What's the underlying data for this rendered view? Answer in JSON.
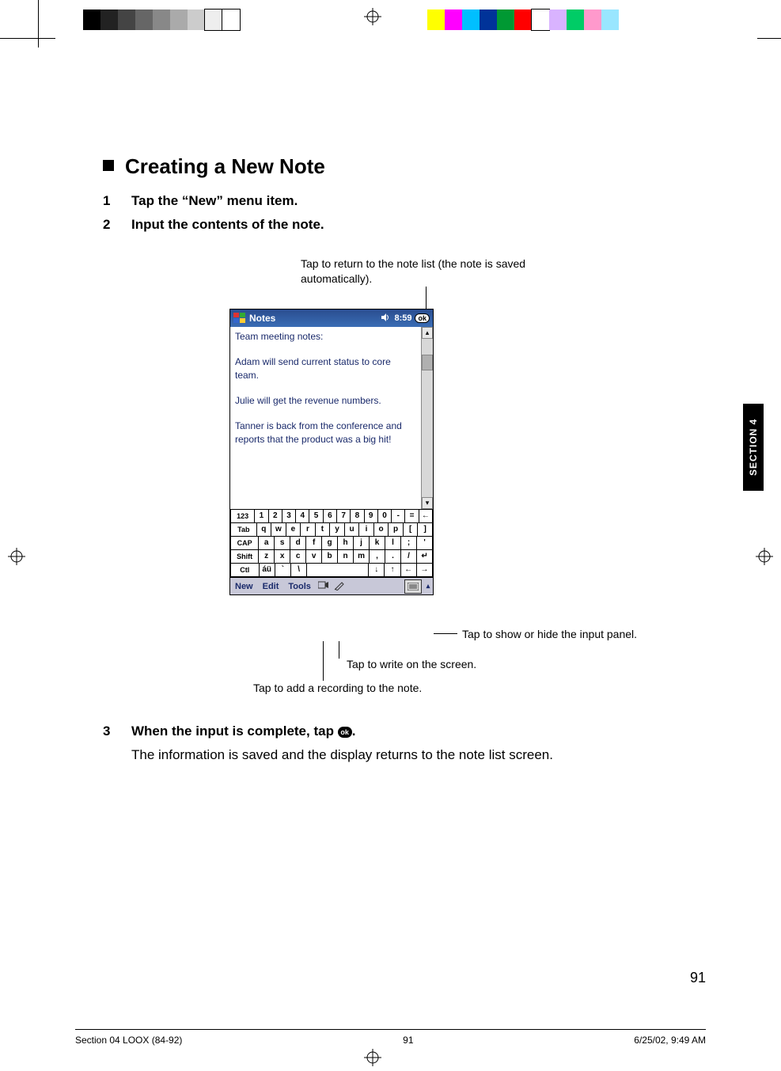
{
  "heading": "Creating a New Note",
  "steps": {
    "s1": {
      "num": "1",
      "text": "Tap the “New” menu item."
    },
    "s2": {
      "num": "2",
      "text": "Input the contents of the note."
    },
    "s3": {
      "num": "3",
      "text_before": "When the input is complete, tap ",
      "text_after": ".",
      "ok_label": "ok",
      "sub": "The information is saved and the display returns to the note list screen."
    }
  },
  "callouts": {
    "ok": "Tap to return to the note list\n(the note is saved automatically).",
    "sip": "Tap to show or hide the input panel.",
    "pen": "Tap to write on the screen.",
    "rec": "Tap to add a recording to the note."
  },
  "screenshot": {
    "title": "Notes",
    "time": "8:59",
    "ok_btn": "ok",
    "note_lines": "Team meeting notes:\n\nAdam will send current status to core team.\n\nJulie will get the revenue numbers.\n\nTanner is back from the conference and reports that the product was a big hit!",
    "keyboard": {
      "row1": [
        "123",
        "1",
        "2",
        "3",
        "4",
        "5",
        "6",
        "7",
        "8",
        "9",
        "0",
        "-",
        "=",
        "←"
      ],
      "row2": [
        "Tab",
        "q",
        "w",
        "e",
        "r",
        "t",
        "y",
        "u",
        "i",
        "o",
        "p",
        "[",
        "]"
      ],
      "row3": [
        "CAP",
        "a",
        "s",
        "d",
        "f",
        "g",
        "h",
        "j",
        "k",
        "l",
        ";",
        "'"
      ],
      "row4": [
        "Shift",
        "z",
        "x",
        "c",
        "v",
        "b",
        "n",
        "m",
        ",",
        ".",
        "/",
        "↵"
      ],
      "row5": [
        "Ctl",
        "áü",
        "`",
        "\\",
        "",
        "",
        "",
        "",
        "↓",
        "↑",
        "←",
        "→"
      ]
    },
    "cmdbar": {
      "new": "New",
      "edit": "Edit",
      "tools": "Tools"
    }
  },
  "side_tab": "SECTION 4",
  "page_number": "91",
  "footer": {
    "file": "Section 04 LOOX (84-92)",
    "page": "91",
    "date": "6/25/02, 9:49 AM"
  },
  "colorbar_swatches": [
    "#000",
    "#333",
    "#555",
    "#777",
    "#999",
    "#bbb",
    "#ddd",
    "#fff"
  ],
  "colorbar_swatches2": [
    "#ffff00",
    "#ff00ff",
    "#00bfff",
    "#003399",
    "#009933",
    "#ff0000",
    "#ffffff",
    "#e4b5ff",
    "#00cc66",
    "#ff99cc",
    "#99e6ff"
  ]
}
